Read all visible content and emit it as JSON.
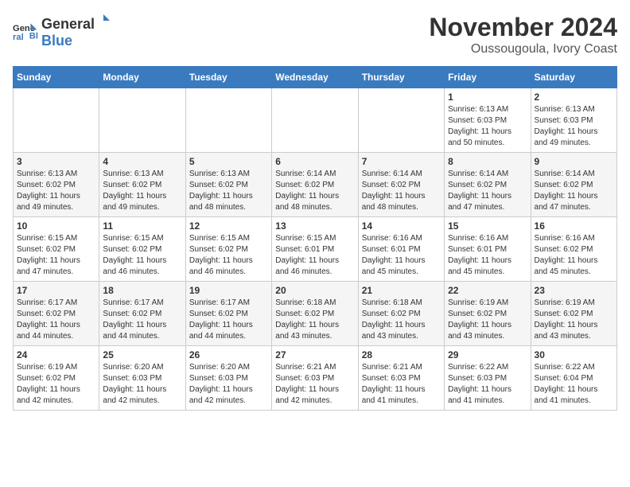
{
  "logo": {
    "line1": "General",
    "line2": "Blue"
  },
  "title": "November 2024",
  "location": "Oussougoula, Ivory Coast",
  "days_of_week": [
    "Sunday",
    "Monday",
    "Tuesday",
    "Wednesday",
    "Thursday",
    "Friday",
    "Saturday"
  ],
  "weeks": [
    [
      {
        "day": "",
        "content": ""
      },
      {
        "day": "",
        "content": ""
      },
      {
        "day": "",
        "content": ""
      },
      {
        "day": "",
        "content": ""
      },
      {
        "day": "",
        "content": ""
      },
      {
        "day": "1",
        "content": "Sunrise: 6:13 AM\nSunset: 6:03 PM\nDaylight: 11 hours\nand 50 minutes."
      },
      {
        "day": "2",
        "content": "Sunrise: 6:13 AM\nSunset: 6:03 PM\nDaylight: 11 hours\nand 49 minutes."
      }
    ],
    [
      {
        "day": "3",
        "content": "Sunrise: 6:13 AM\nSunset: 6:02 PM\nDaylight: 11 hours\nand 49 minutes."
      },
      {
        "day": "4",
        "content": "Sunrise: 6:13 AM\nSunset: 6:02 PM\nDaylight: 11 hours\nand 49 minutes."
      },
      {
        "day": "5",
        "content": "Sunrise: 6:13 AM\nSunset: 6:02 PM\nDaylight: 11 hours\nand 48 minutes."
      },
      {
        "day": "6",
        "content": "Sunrise: 6:14 AM\nSunset: 6:02 PM\nDaylight: 11 hours\nand 48 minutes."
      },
      {
        "day": "7",
        "content": "Sunrise: 6:14 AM\nSunset: 6:02 PM\nDaylight: 11 hours\nand 48 minutes."
      },
      {
        "day": "8",
        "content": "Sunrise: 6:14 AM\nSunset: 6:02 PM\nDaylight: 11 hours\nand 47 minutes."
      },
      {
        "day": "9",
        "content": "Sunrise: 6:14 AM\nSunset: 6:02 PM\nDaylight: 11 hours\nand 47 minutes."
      }
    ],
    [
      {
        "day": "10",
        "content": "Sunrise: 6:15 AM\nSunset: 6:02 PM\nDaylight: 11 hours\nand 47 minutes."
      },
      {
        "day": "11",
        "content": "Sunrise: 6:15 AM\nSunset: 6:02 PM\nDaylight: 11 hours\nand 46 minutes."
      },
      {
        "day": "12",
        "content": "Sunrise: 6:15 AM\nSunset: 6:02 PM\nDaylight: 11 hours\nand 46 minutes."
      },
      {
        "day": "13",
        "content": "Sunrise: 6:15 AM\nSunset: 6:01 PM\nDaylight: 11 hours\nand 46 minutes."
      },
      {
        "day": "14",
        "content": "Sunrise: 6:16 AM\nSunset: 6:01 PM\nDaylight: 11 hours\nand 45 minutes."
      },
      {
        "day": "15",
        "content": "Sunrise: 6:16 AM\nSunset: 6:01 PM\nDaylight: 11 hours\nand 45 minutes."
      },
      {
        "day": "16",
        "content": "Sunrise: 6:16 AM\nSunset: 6:02 PM\nDaylight: 11 hours\nand 45 minutes."
      }
    ],
    [
      {
        "day": "17",
        "content": "Sunrise: 6:17 AM\nSunset: 6:02 PM\nDaylight: 11 hours\nand 44 minutes."
      },
      {
        "day": "18",
        "content": "Sunrise: 6:17 AM\nSunset: 6:02 PM\nDaylight: 11 hours\nand 44 minutes."
      },
      {
        "day": "19",
        "content": "Sunrise: 6:17 AM\nSunset: 6:02 PM\nDaylight: 11 hours\nand 44 minutes."
      },
      {
        "day": "20",
        "content": "Sunrise: 6:18 AM\nSunset: 6:02 PM\nDaylight: 11 hours\nand 43 minutes."
      },
      {
        "day": "21",
        "content": "Sunrise: 6:18 AM\nSunset: 6:02 PM\nDaylight: 11 hours\nand 43 minutes."
      },
      {
        "day": "22",
        "content": "Sunrise: 6:19 AM\nSunset: 6:02 PM\nDaylight: 11 hours\nand 43 minutes."
      },
      {
        "day": "23",
        "content": "Sunrise: 6:19 AM\nSunset: 6:02 PM\nDaylight: 11 hours\nand 43 minutes."
      }
    ],
    [
      {
        "day": "24",
        "content": "Sunrise: 6:19 AM\nSunset: 6:02 PM\nDaylight: 11 hours\nand 42 minutes."
      },
      {
        "day": "25",
        "content": "Sunrise: 6:20 AM\nSunset: 6:03 PM\nDaylight: 11 hours\nand 42 minutes."
      },
      {
        "day": "26",
        "content": "Sunrise: 6:20 AM\nSunset: 6:03 PM\nDaylight: 11 hours\nand 42 minutes."
      },
      {
        "day": "27",
        "content": "Sunrise: 6:21 AM\nSunset: 6:03 PM\nDaylight: 11 hours\nand 42 minutes."
      },
      {
        "day": "28",
        "content": "Sunrise: 6:21 AM\nSunset: 6:03 PM\nDaylight: 11 hours\nand 41 minutes."
      },
      {
        "day": "29",
        "content": "Sunrise: 6:22 AM\nSunset: 6:03 PM\nDaylight: 11 hours\nand 41 minutes."
      },
      {
        "day": "30",
        "content": "Sunrise: 6:22 AM\nSunset: 6:04 PM\nDaylight: 11 hours\nand 41 minutes."
      }
    ]
  ]
}
